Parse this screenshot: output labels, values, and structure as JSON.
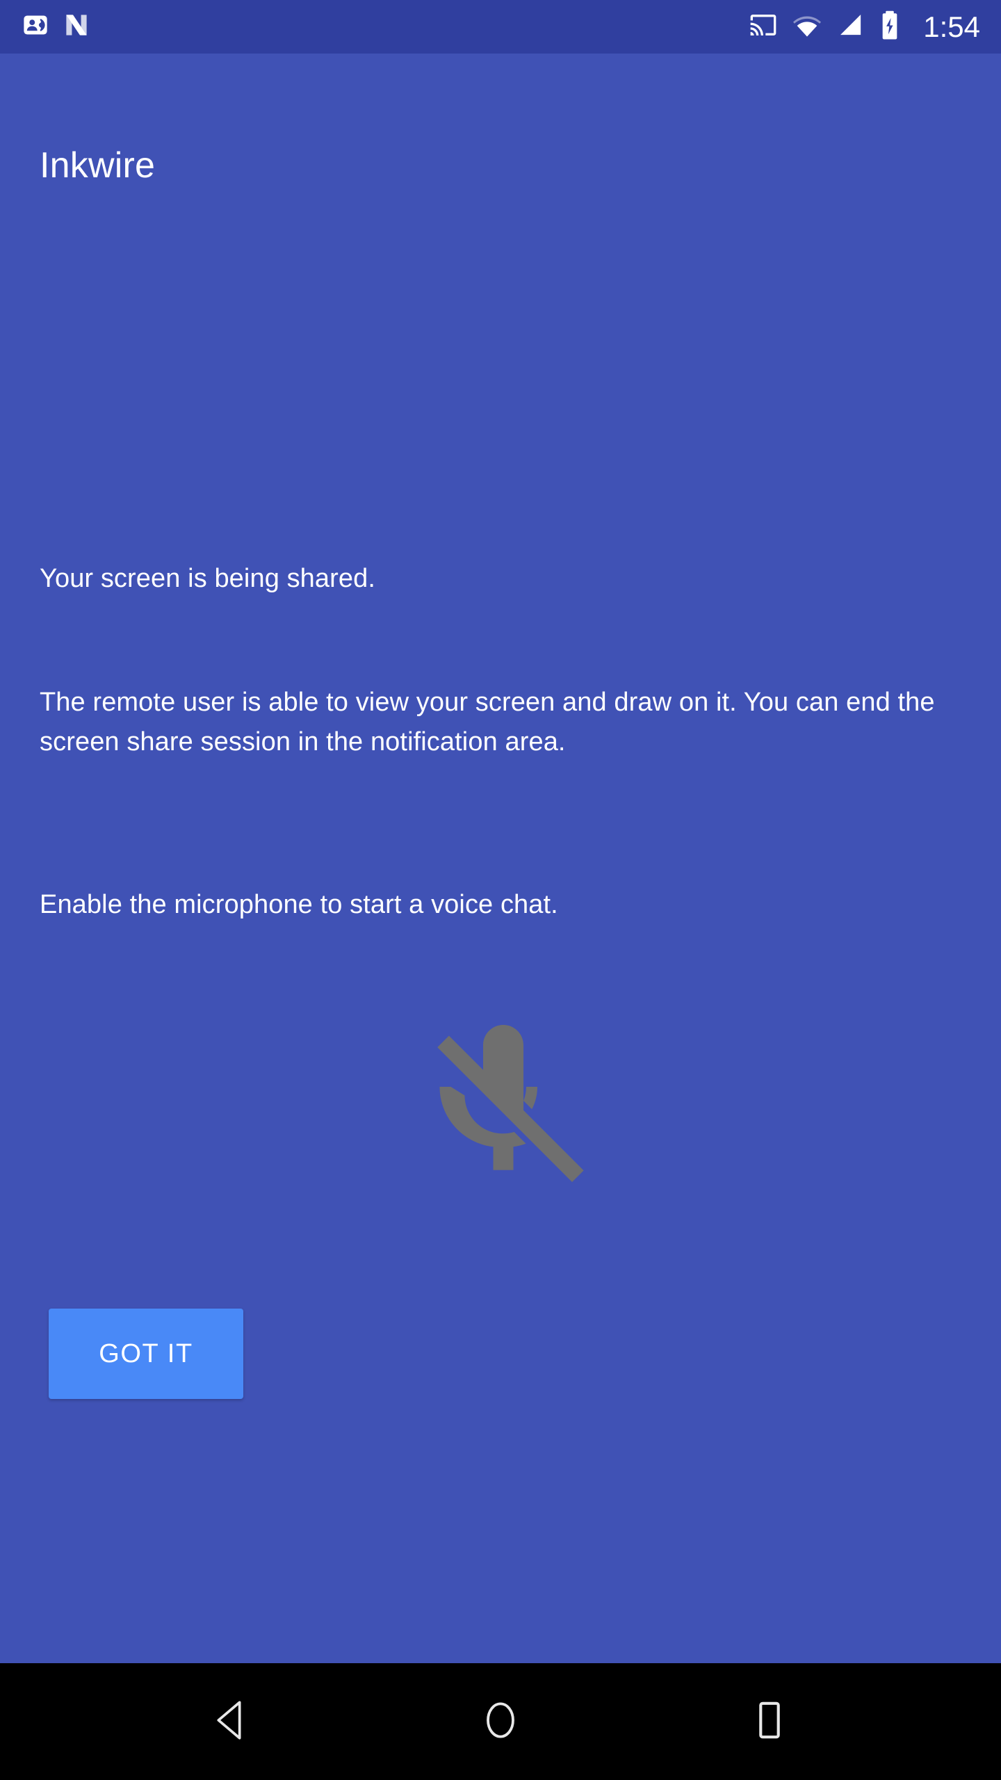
{
  "status_bar": {
    "background_color": "#303f9f",
    "time": "1:54",
    "left_icons": [
      {
        "name": "contacts-phone-icon",
        "label": "Contacts"
      },
      {
        "name": "android-nougat-icon",
        "label": "Android N"
      }
    ],
    "right_icons": [
      {
        "name": "cast-icon",
        "label": "Screen casting"
      },
      {
        "name": "wifi-icon",
        "label": "Wi-Fi"
      },
      {
        "name": "cellular-signal-icon",
        "label": "Cellular signal"
      },
      {
        "name": "battery-charging-icon",
        "label": "Battery charging"
      }
    ]
  },
  "app": {
    "background_color": "#4052b5",
    "title": "Inkwire",
    "status_line": "Your screen is being shared.",
    "description": "The remote user is able to view your screen and draw on it. You can end the screen share session in the notification area.",
    "mic_prompt": "Enable the microphone to start a voice chat.",
    "mic_icon": {
      "name": "mic-off-icon",
      "state": "muted",
      "color": "#6f6f6f"
    },
    "primary_button": {
      "label": "GOT IT",
      "background_color": "#4989f7",
      "text_color": "#ffffff"
    }
  },
  "navigation_bar": {
    "background_color": "#000000",
    "buttons": [
      {
        "name": "nav-back-button",
        "label": "Back"
      },
      {
        "name": "nav-home-button",
        "label": "Home"
      },
      {
        "name": "nav-recents-button",
        "label": "Recent apps"
      }
    ]
  }
}
